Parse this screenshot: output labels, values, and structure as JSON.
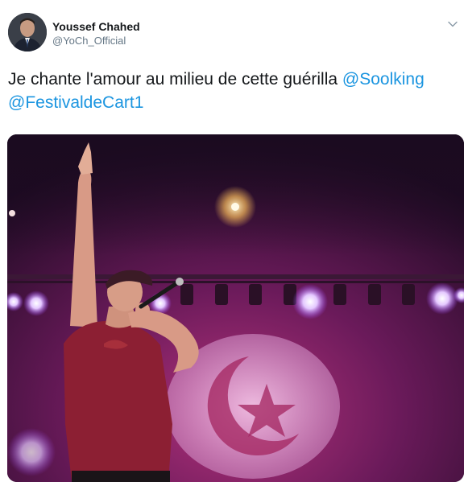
{
  "tweet": {
    "author": {
      "display_name": "Youssef Chahed",
      "handle": "@YoCh_Official"
    },
    "text": {
      "plain": "Je chante l'amour au milieu de cette guérilla ",
      "mentions": [
        "@Soolking",
        "@FestivaldeCart1"
      ]
    },
    "icons": {
      "menu": "chevron-down-icon"
    },
    "colors": {
      "mention": "#1b95e0",
      "secondary_text": "#657786"
    }
  }
}
